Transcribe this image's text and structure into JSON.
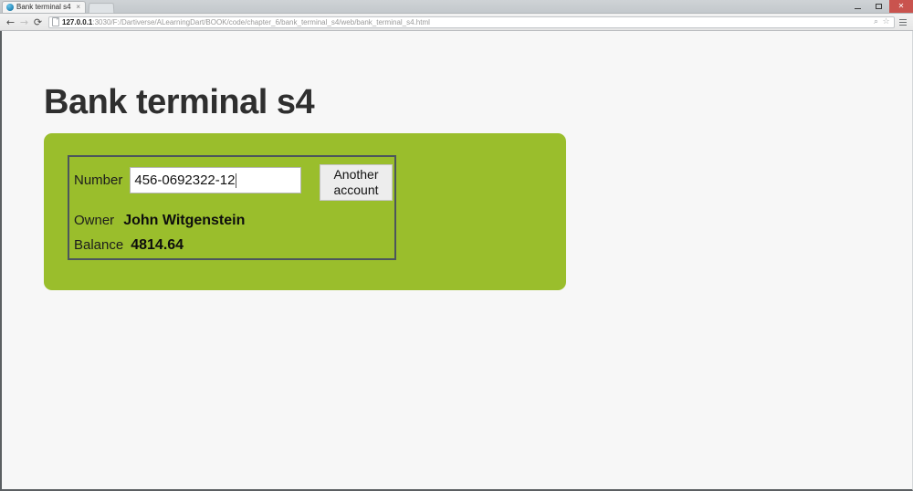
{
  "window": {
    "controls": {
      "minimize": "–",
      "maximize": "❐",
      "close": "✕"
    }
  },
  "tabstrip": {
    "tab": {
      "title": "Bank terminal s4",
      "close_label": "×",
      "favicon": "globe-favicon"
    },
    "new_tab_label": ""
  },
  "toolbar": {
    "back_glyph": "←",
    "forward_glyph": "→",
    "reload_glyph": "⟳",
    "url_host": "127.0.0.1",
    "url_rest": ":3030/F:/Dartiverse/ALearningDart/BOOK/code/chapter_6/bank_terminal_s4/web/bank_terminal_s4.html",
    "url_full": "127.0.0.1:3030/F:/Dartiverse/ALearningDart/BOOK/code/chapter_6/bank_terminal_s4/web/bank_terminal_s4.html",
    "zoom_glyph": "⌕",
    "star_glyph": "☆"
  },
  "page": {
    "title": "Bank terminal s4",
    "panel_color": "#9abe2c",
    "form": {
      "number_label": "Number",
      "number_value": "456-0692322-12",
      "number_placeholder": "",
      "button_label": "Another account",
      "owner_label": "Owner",
      "owner_value": "John Witgenstein",
      "balance_label": "Balance",
      "balance_value": "4814.64"
    }
  }
}
